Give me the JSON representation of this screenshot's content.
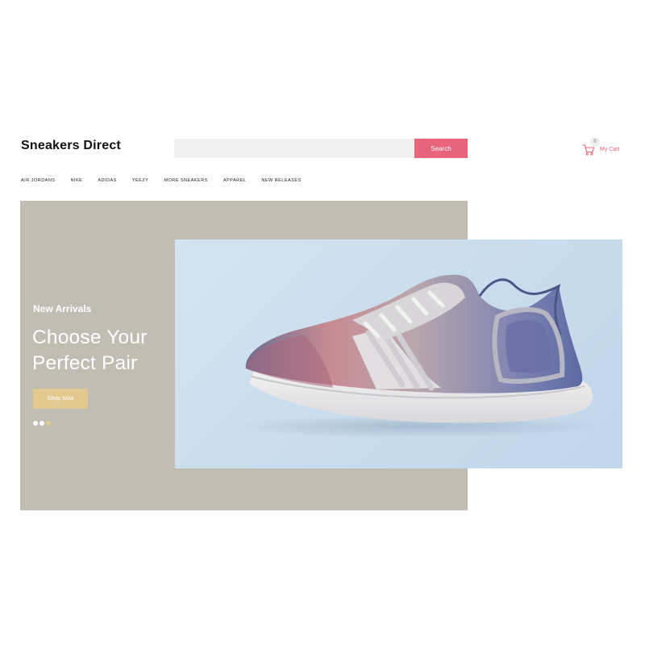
{
  "header": {
    "logo": "Sneakers Direct",
    "search": {
      "value": "",
      "placeholder": "",
      "button_label": "Search"
    },
    "cart": {
      "count": "0",
      "label": "My Cart",
      "icon": "cart-icon"
    }
  },
  "nav": {
    "items": [
      "AIR JORDANS",
      "NIKE",
      "ADIDAS",
      "YEEZY",
      "MORE SNEAKERS",
      "APPAREL",
      "NEW RELEASES"
    ]
  },
  "hero": {
    "kicker": "New Arrivals",
    "title_line1": "Choose Your",
    "title_line2": "Perfect Pair",
    "button_label": "Shop Now",
    "slides": {
      "total": 3,
      "active": 1
    }
  },
  "colors": {
    "accent_pink": "#e8637c",
    "accent_gold": "#e2c98f",
    "hero_bg": "#c1bdb2",
    "image_bg": "#cddfef"
  }
}
